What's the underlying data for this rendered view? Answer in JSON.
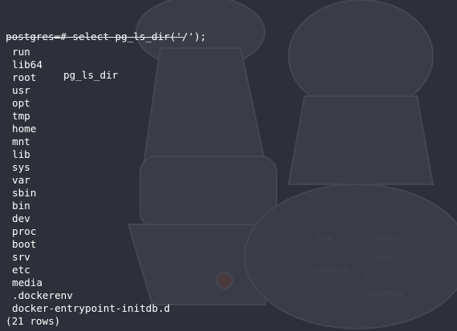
{
  "terminal": {
    "prompt": "postgres=#",
    "command": "select pg_ls_dir('/');",
    "column_header": "pg_ls_dir",
    "rows": [
      "run",
      "lib64",
      "root",
      "usr",
      "opt",
      "tmp",
      "home",
      "mnt",
      "lib",
      "sys",
      "var",
      "sbin",
      "bin",
      "dev",
      "proc",
      "boot",
      "srv",
      "etc",
      "media",
      ".dockerenv",
      "docker-entrypoint-initdb.d"
    ],
    "row_count": "(21 rows)"
  },
  "theme": {
    "background": "#2d3038",
    "text": "#ffffff"
  }
}
